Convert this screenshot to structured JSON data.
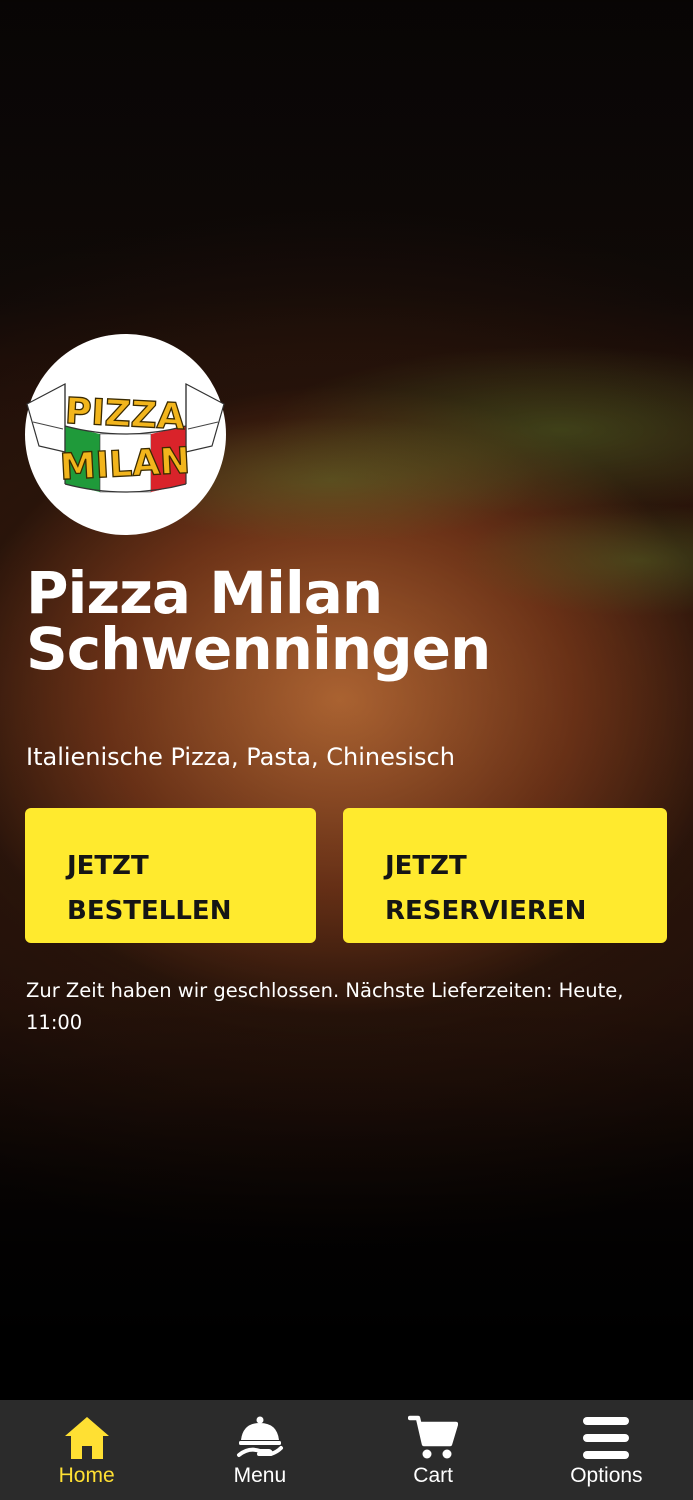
{
  "restaurant": {
    "logo_text": [
      "PIZZA",
      "MILAN"
    ],
    "name_lines": [
      "Pizza Milan",
      "Schwenningen"
    ],
    "cuisine": "Italienische Pizza, Pasta, Chinesisch"
  },
  "actions": {
    "order_lines": [
      "JETZT",
      "BESTELLEN"
    ],
    "reserve_lines": [
      "JETZT",
      "RESERVIEREN"
    ]
  },
  "status_text": "Zur Zeit haben wir geschlossen. Nächste Lieferzeiten: Heute, 11:00",
  "tabbar": {
    "active": "home",
    "items": [
      {
        "id": "home",
        "label": "Home",
        "icon": "home-icon"
      },
      {
        "id": "menu",
        "label": "Menu",
        "icon": "cloche-icon"
      },
      {
        "id": "cart",
        "label": "Cart",
        "icon": "cart-icon"
      },
      {
        "id": "options",
        "label": "Options",
        "icon": "hamburger-icon"
      }
    ]
  },
  "colors": {
    "accent": "#ffea2e",
    "active_tab": "#ffe033",
    "tabbar_bg": "#2b2b2b",
    "button_text": "#151515"
  }
}
